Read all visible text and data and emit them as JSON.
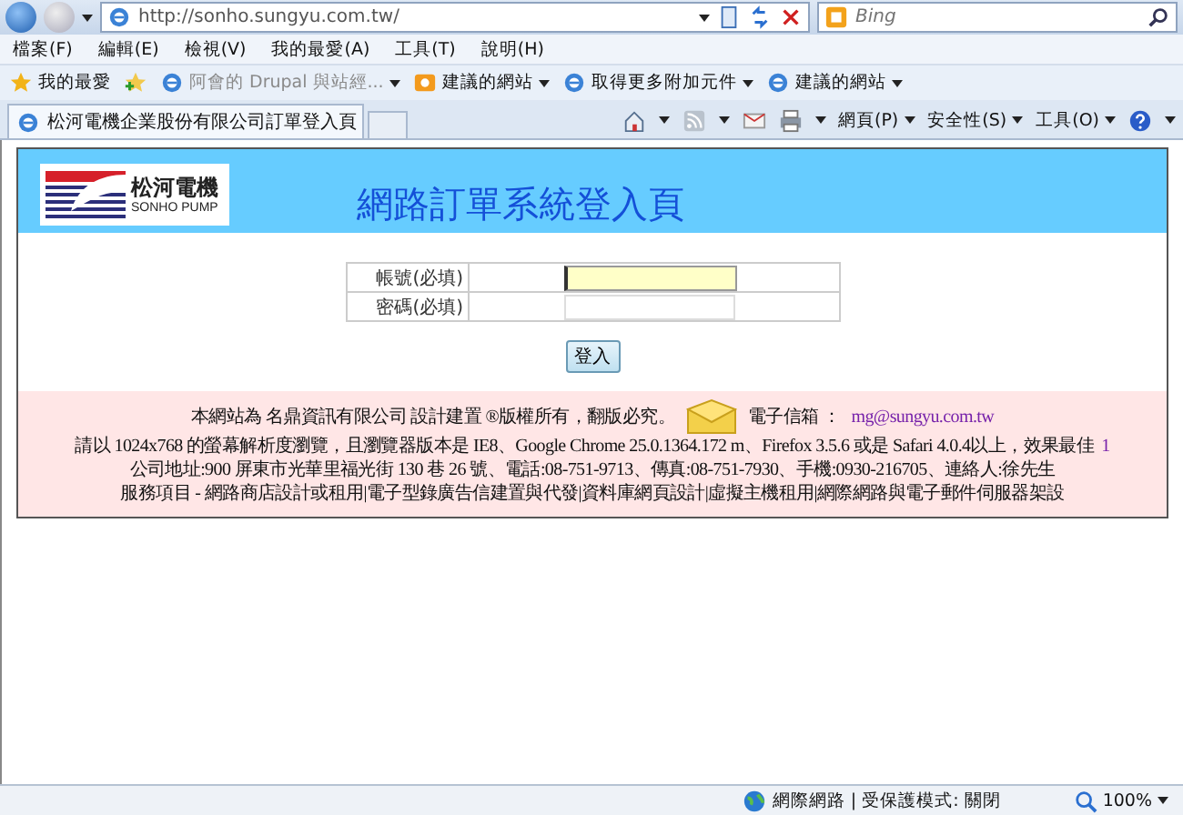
{
  "browser": {
    "address": "http://sonho.sungyu.com.tw/",
    "search": {
      "placeholder": "Bing"
    },
    "menu": [
      "檔案(F)",
      "編輯(E)",
      "檢視(V)",
      "我的最愛(A)",
      "工具(T)",
      "說明(H)"
    ],
    "favorites": [
      {
        "kind": "star",
        "label": "我的最愛",
        "disabled": false
      },
      {
        "kind": "page",
        "label": "阿會的 Drupal 與站經...",
        "disabled": true
      },
      {
        "kind": "slice",
        "label": "建議的網站",
        "disabled": false
      },
      {
        "kind": "page",
        "label": "取得更多附加元件",
        "disabled": false
      },
      {
        "kind": "page",
        "label": "建議的網站",
        "disabled": false
      }
    ],
    "tabs": [
      {
        "label": "松河電機企業股份有限公司訂單登入頁",
        "selected": true
      }
    ],
    "commands": [
      "網頁(P)",
      "安全性(S)",
      "工具(O)"
    ],
    "status": {
      "zone": "網際網路 | 受保護模式: 關閉",
      "zoom": "100%"
    }
  },
  "page": {
    "logo": {
      "name": "松河電機",
      "sub": "SONHO PUMP"
    },
    "title": "網路訂單系統登入頁",
    "form": {
      "fields": [
        {
          "label": "帳號(必填)",
          "focused": true
        },
        {
          "label": "密碼(必填)",
          "focused": false
        }
      ],
      "submit": "登入"
    },
    "footer": {
      "credit": "本網站為 名鼎資訊有限公司 設計建置 ®版權所有，翻版必究。",
      "email_label": "電子信箱 ：",
      "email": "mg@sungyu.com.tw",
      "browsers": "請以 1024x768 的螢幕解析度瀏覽，且瀏覽器版本是 IE8、Google Chrome 25.0.1364.172 m、Firefox 3.5.6 或是 Safari 4.0.4以上，效果最佳",
      "browsers_link": "1",
      "address": "公司地址:900 屏東市光華里福光街 130 巷 26 號、電話:08-751-9713、傳真:08-751-7930、手機:0930-216705、連絡人:徐先生",
      "services": "服務項目 - 網路商店設計或租用|電子型錄廣告信建置與代發|資料庫網頁設計|虛擬主機租用|網際網路與電子郵件伺服器架設"
    }
  }
}
